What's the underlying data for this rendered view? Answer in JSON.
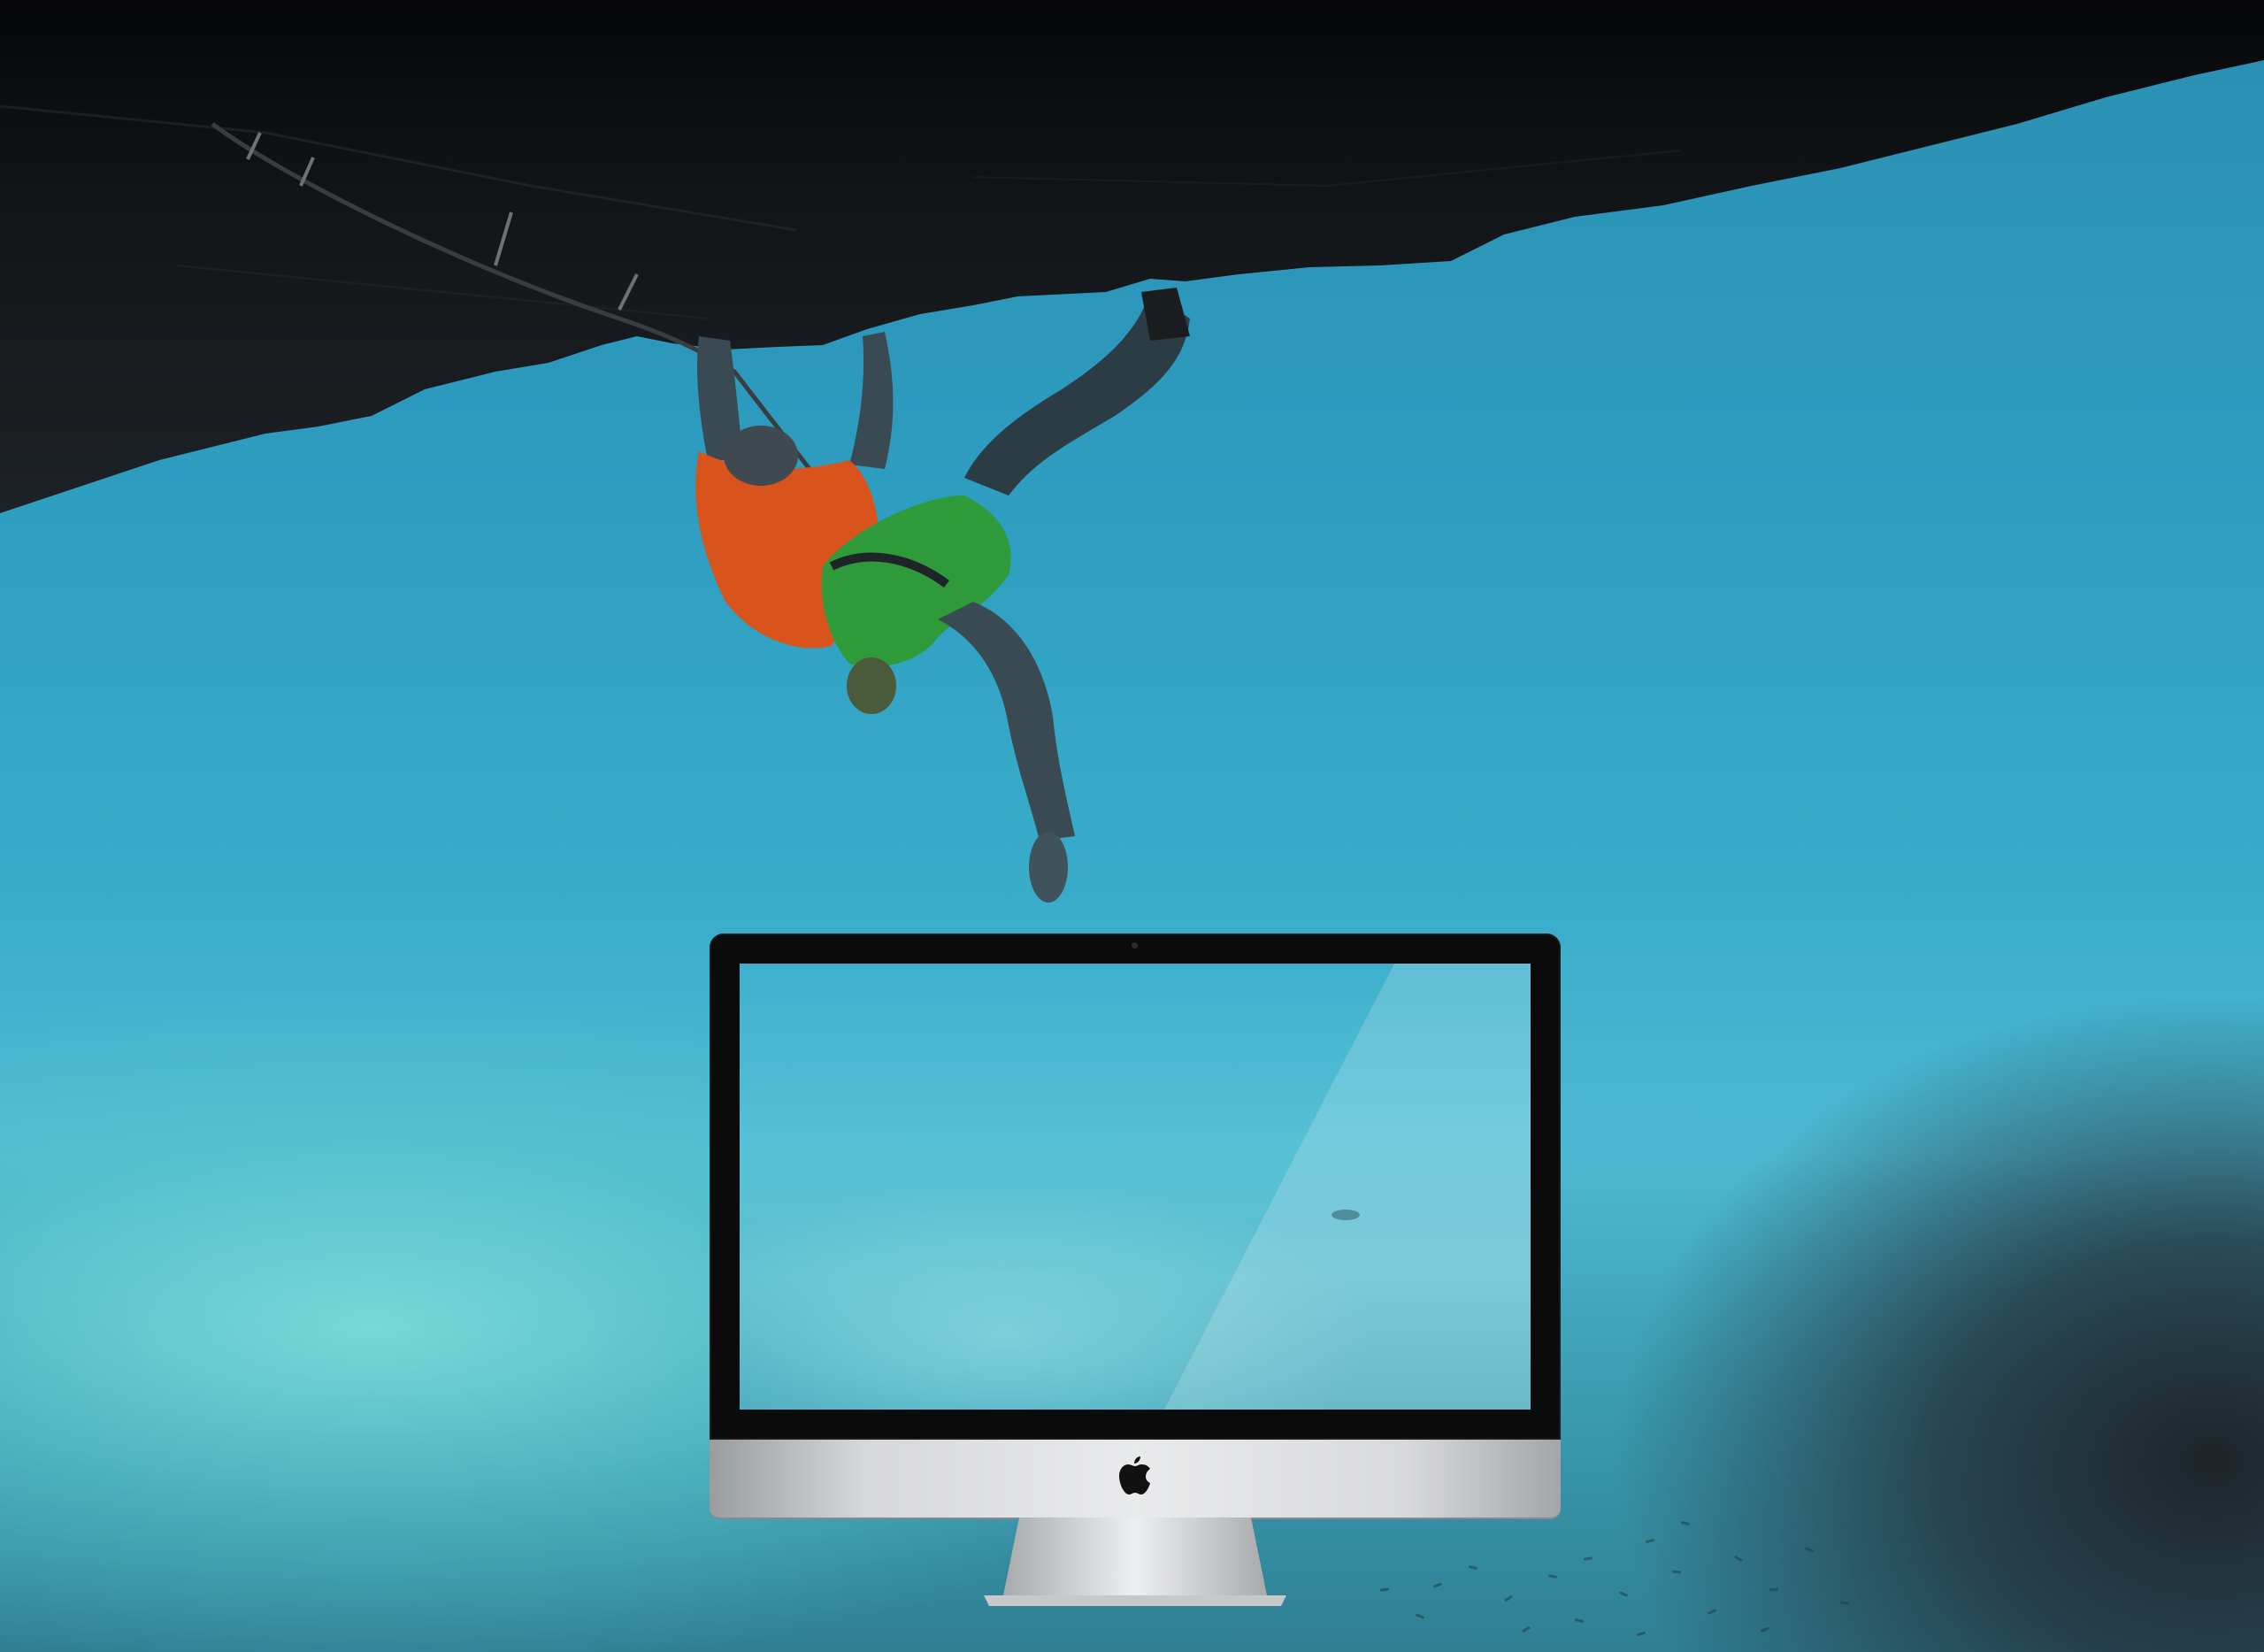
{
  "scene": {
    "description_icons": [
      "rock-overhang",
      "climber",
      "imac-display",
      "apple-logo-icon"
    ],
    "colors": {
      "sky_blue": "#2d9dc0",
      "water_light": "#82e1dc",
      "rock_dark": "#15181c",
      "shirt_orange": "#d9541c",
      "shorts_green": "#2f9a3a",
      "bezel_black": "#0b0b0c",
      "aluminum": "#e9eaeb"
    }
  }
}
